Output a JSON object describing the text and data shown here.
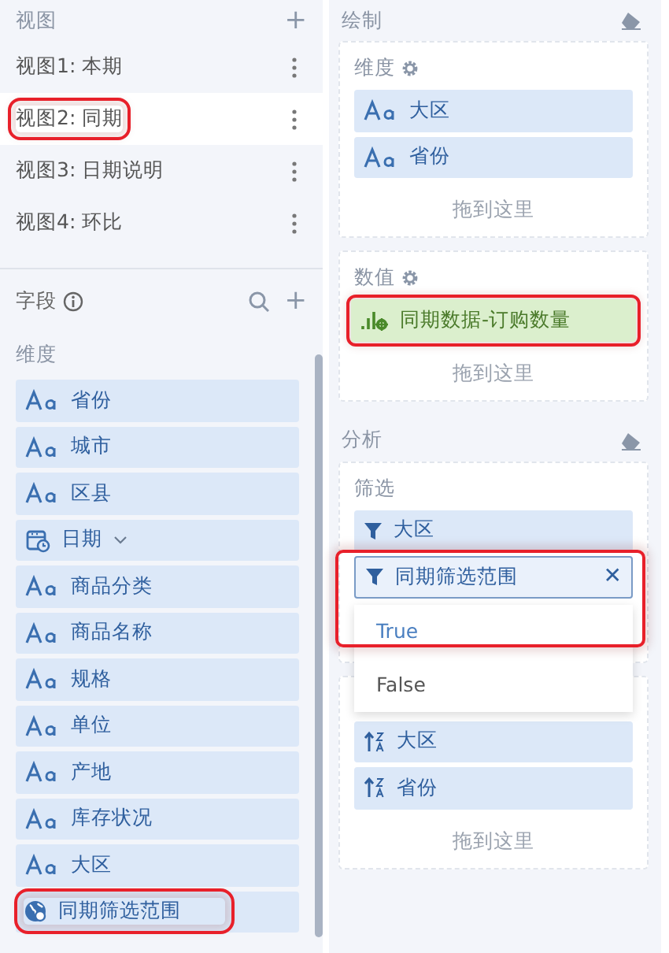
{
  "views_panel": {
    "title": "视图",
    "add": "+",
    "views": [
      {
        "label": "视图1: 本期",
        "selected": false,
        "highlighted": false
      },
      {
        "label": "视图2: 同期",
        "selected": true,
        "highlighted": true
      },
      {
        "label": "视图3: 日期说明",
        "selected": false,
        "highlighted": false
      },
      {
        "label": "视图4: 环比",
        "selected": false,
        "highlighted": false
      }
    ]
  },
  "fields_panel": {
    "title": "字段",
    "add": "+",
    "group": "维度",
    "fields": [
      {
        "kind": "text",
        "label": "省份",
        "highlighted": false
      },
      {
        "kind": "text",
        "label": "城市",
        "highlighted": false
      },
      {
        "kind": "text",
        "label": "区县",
        "highlighted": false
      },
      {
        "kind": "date",
        "label": "日期",
        "highlighted": false
      },
      {
        "kind": "text",
        "label": "商品分类",
        "highlighted": false
      },
      {
        "kind": "text",
        "label": "商品名称",
        "highlighted": false
      },
      {
        "kind": "text",
        "label": "规格",
        "highlighted": false
      },
      {
        "kind": "text",
        "label": "单位",
        "highlighted": false
      },
      {
        "kind": "text",
        "label": "产地",
        "highlighted": false
      },
      {
        "kind": "text",
        "label": "库存状况",
        "highlighted": false
      },
      {
        "kind": "text",
        "label": "大区",
        "highlighted": false
      },
      {
        "kind": "geo",
        "label": "同期筛选范围",
        "highlighted": true
      }
    ]
  },
  "draw_panel": {
    "title": "绘制",
    "dimensions": {
      "title": "维度",
      "items": [
        {
          "kind": "text",
          "label": "大区"
        },
        {
          "kind": "text",
          "label": "省份"
        }
      ],
      "drop_hint": "拖到这里"
    },
    "values": {
      "title": "数值",
      "items": [
        {
          "kind": "measure",
          "label": "同期数据-订购数量",
          "highlighted": true
        }
      ],
      "drop_hint": "拖到这里"
    }
  },
  "analysis_panel": {
    "title": "分析",
    "filters": {
      "title": "筛选",
      "items": [
        {
          "label": "大区",
          "highlighted": false
        },
        {
          "label": "同期筛选范围",
          "highlighted": true,
          "close": "✕",
          "options": [
            {
              "label": "True",
              "selected": true
            },
            {
              "label": "False",
              "selected": false
            }
          ]
        }
      ]
    },
    "sorts": {
      "items": [
        {
          "label": "大区"
        },
        {
          "label": "省份"
        }
      ],
      "drop_hint": "拖到这里"
    }
  }
}
